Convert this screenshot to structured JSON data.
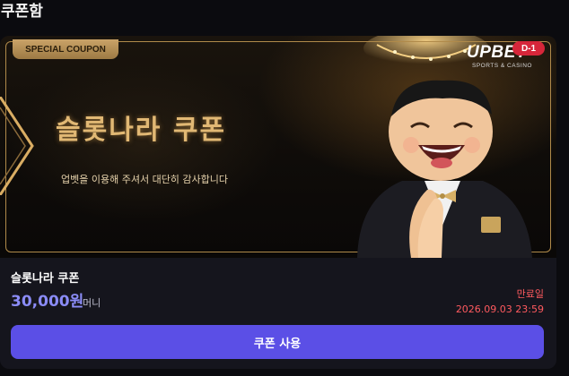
{
  "page": {
    "title": "쿠폰함"
  },
  "coupon": {
    "banner": {
      "tag": "SPECIAL COUPON",
      "headline": "슬롯나라 쿠폰",
      "subtitle": "업벳을 이용해 주셔서 대단히 감사합니다",
      "brand": {
        "name": "UPBET",
        "tagline": "SPORTS & CASINO"
      },
      "dday": "D-1"
    },
    "name": "슬롯나라 쿠폰",
    "amount": "30,000원",
    "unit": "머니",
    "expire_label": "만료일",
    "expire_date": "2026.09.03 23:59",
    "use_button": "쿠폰 사용"
  },
  "colors": {
    "accent": "#5b4fe6",
    "amount": "#8b8cf7",
    "expire": "#ff5a5f",
    "gold": "#e1b874",
    "badge": "#d6263a"
  }
}
